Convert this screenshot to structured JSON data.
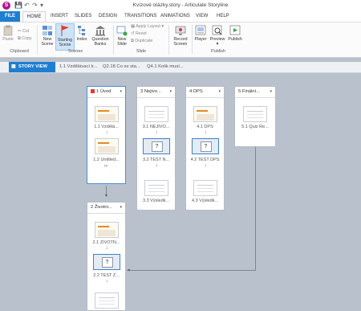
{
  "window": {
    "title": "Kvízové otázky.story - Articulate Storyline",
    "logo_letter": "S",
    "quick_access": [
      "💾",
      "↶",
      "↷",
      "▾"
    ]
  },
  "tabs": [
    "FILE",
    "HOME",
    "INSERT",
    "SLIDES",
    "DESIGN",
    "TRANSITIONS",
    "ANIMATIONS",
    "VIEW",
    "HELP"
  ],
  "ribbon": {
    "clipboard": {
      "paste": "Paste",
      "cut": "Cut",
      "copy": "Copy",
      "group": "Clipboard"
    },
    "scenes": {
      "new_scene": "New\nScene",
      "starting_scene": "Starting\nScene",
      "index": "Index",
      "question_banks": "Question\nBanks",
      "group": "Scenes"
    },
    "slide": {
      "new_slide": "New\nSlide",
      "apply_layout": "Apply Layout",
      "reset": "Reset",
      "duplicate": "Duplicate",
      "group": "Slide"
    },
    "record": {
      "label": "Record\nScreen"
    },
    "publish": {
      "player": "Player",
      "preview": "Preview",
      "publish": "Publish",
      "group": "Publish"
    }
  },
  "story_view": {
    "tab": "STORY VIEW",
    "crumbs": [
      "1.1 Vzdělávací k...",
      "Q2.18 Co se sta...",
      "Q4.1 Kolik musí..."
    ]
  },
  "scenes": [
    {
      "title": "1 Úvod",
      "slides": [
        "1.1 Vzdělá...",
        "1.2 Untitled..."
      ]
    },
    {
      "title": "3 Nejivo...",
      "slides": [
        "3.1 NEJIVO...",
        "3.2 TEST N...",
        "3.3 Výsledk..."
      ]
    },
    {
      "title": "4 DPS",
      "slides": [
        "4.1 DPS",
        "4.2 TEST DPS",
        "4.3 Výsledk..."
      ]
    },
    {
      "title": "5 Finální...",
      "slides": [
        "5.1 Quiz Re..."
      ]
    },
    {
      "title": "2 Životni...",
      "slides": [
        "2.1 ŽIVOTN...",
        "2.2 TEST Ž..."
      ]
    }
  ]
}
